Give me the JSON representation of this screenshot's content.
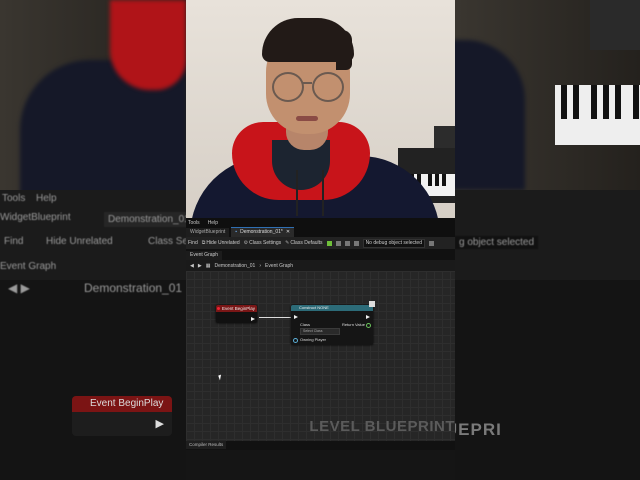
{
  "background": {
    "left_menu": [
      "Tools",
      "Help"
    ],
    "left_widget_label": "WidgetBlueprint",
    "left_tab": "Demonstration_01",
    "left_toolbar": [
      "Find",
      "Hide Unrelated",
      "Class Se"
    ],
    "left_graph_tab": "Event Graph",
    "left_breadcrumb": "Demonstration_01",
    "left_node_title": "Event BeginPlay",
    "right_debug_select": "g object selected",
    "watermark_fragment": "LEVEL BLUEPRI"
  },
  "editor": {
    "menu": [
      "Tools",
      "Help"
    ],
    "tabs": [
      {
        "label": "WidgetBlueprint",
        "active": false
      },
      {
        "label": "Demonstration_01*",
        "active": true
      }
    ],
    "toolbar": {
      "find": "Find",
      "hide_unrelated": "Hide Unrelated",
      "class_settings": "Class Settings",
      "class_defaults": "Class Defaults",
      "debug_select": "No debug object selected"
    },
    "graph_tab": "Event Graph",
    "breadcrumb": {
      "root": "Demonstration_01",
      "current": "Event Graph"
    },
    "nodes": {
      "begin_play": {
        "title": "Event BeginPlay"
      },
      "construct": {
        "title": "Construct NONE",
        "class_label": "Class",
        "class_value": "Select Class",
        "return_label": "Return Value",
        "owning_player": "Owning Player"
      }
    },
    "watermark": "LEVEL BLUEPRINT",
    "bottom_tab": "Compiler Results"
  },
  "colors": {
    "event_header": "#7a1616",
    "construct_header": "#2c6b78",
    "accent": "#2f6fb3"
  }
}
